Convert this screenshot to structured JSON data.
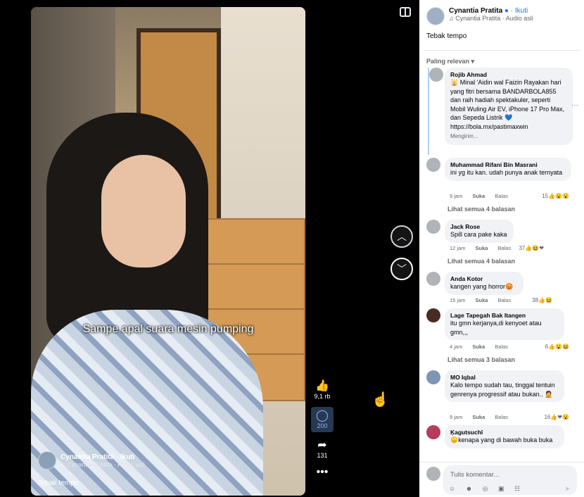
{
  "video": {
    "caption_overlay": "Sampe apal suara mesin pumping",
    "author": "Cynantia Pratita",
    "follow": "· Ikuti",
    "audio": "♫ Cynantia Pratita · Audio asli",
    "post_caption": "Tebak tempo",
    "actions": {
      "likes": "9,1 rb",
      "comments": "200",
      "shares": "131"
    }
  },
  "panel": {
    "author": "Cynantia Pratita",
    "follow": "· Ikuti",
    "audio": "♫ Cynantia Pratita · Audio asli",
    "caption": "Tebak tempo",
    "sort_label": "Paling relevan ▾",
    "comments": [
      {
        "author": "Rojib Ahmad",
        "text": "🕌 Minal 'Aidin wal Faizin Rayakan hari yang fitri bersama BANDARBOLA855 dan raih hadiah spektakuler, seperti Mobil Wuling Air EV, iPhone 17 Pro Max, dan Sepeda Listrik 💙 https://bola.mx/pastimaxwin",
        "time": "Mengirim..."
      },
      {
        "author": "Muhammad Rifani Bin Masrani",
        "text": "ini yg itu kan. udah punya anak ternyata",
        "time": "9 jam",
        "like": "Suka",
        "reply": "Balas",
        "reactions": "15👍😮😮",
        "replies": "Lihat semua 4 balasan"
      },
      {
        "author": "Jack Rose",
        "text": "Spill cara pake kaka",
        "time": "12 jam",
        "like": "Suka",
        "reply": "Balas",
        "reactions": "37👍😆❤",
        "replies": "Lihat semua 4 balasan"
      },
      {
        "author": "Anda Kotor",
        "text": "kangen yang horror😡",
        "time": "15 jam",
        "like": "Suka",
        "reply": "Balas",
        "reactions": "38👍😆"
      },
      {
        "author": "Lage Tapegah Bak Itangen",
        "text": "itu gmn kerjanya,di kenyoet atau gmn,,,",
        "time": "4 jam",
        "like": "Suka",
        "reply": "Balas",
        "reactions": "6👍😮😆",
        "replies": "Lihat semua 3 balasan"
      },
      {
        "author": "MO Iqbal",
        "text": "Kalo tempo sudah tau, tinggal tentuin genrenya progressif atau bukan.. 🤦",
        "time": "9 jam",
        "like": "Suka",
        "reply": "Balas",
        "reactions": "16👍❤😮"
      },
      {
        "author": "Ķagutsuchî",
        "text": "😞kenapa yang di bawah buka buka"
      }
    ],
    "compose_placeholder": "Tulis komentar...",
    "compose_icons": "☺ ☻ ◎ ▣ ☷",
    "send_icon": "➤"
  }
}
